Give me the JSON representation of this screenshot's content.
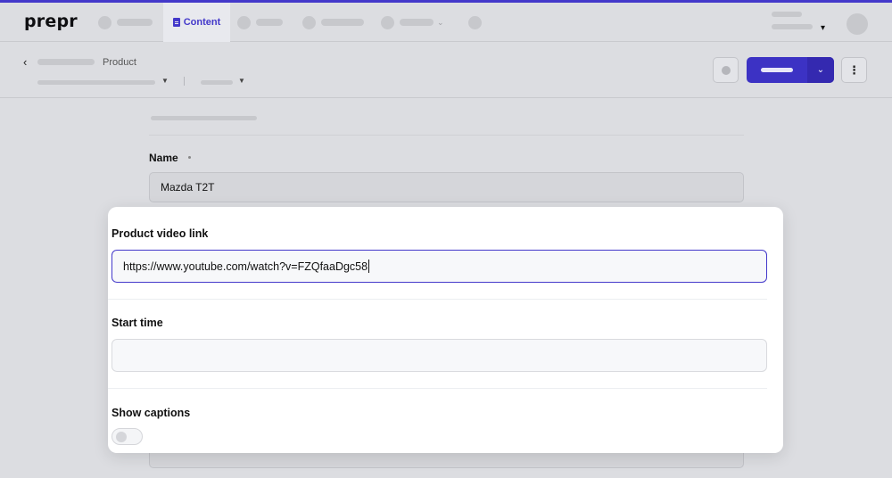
{
  "app": {
    "logo": "prepr",
    "nav": {
      "content_label": "Content"
    },
    "accent": "#4338ca"
  },
  "header": {
    "breadcrumb_label": "Product"
  },
  "form": {
    "name_label": "Name",
    "name_value": "Mazda T2T"
  },
  "modal": {
    "video_link_label": "Product video link",
    "video_link_value": "https://www.youtube.com/watch?v=FZQfaaDgc58",
    "start_time_label": "Start time",
    "start_time_value": "",
    "show_captions_label": "Show captions",
    "show_captions_on": false
  },
  "icons": {
    "back": "chevron-left-icon",
    "content": "document-icon",
    "split": "chevron-down-icon",
    "more": "more-vertical-icon"
  }
}
